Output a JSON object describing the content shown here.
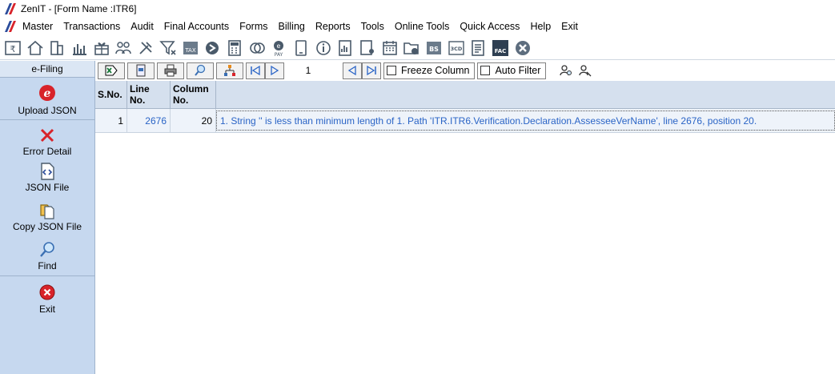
{
  "window": {
    "title": "ZenIT - [Form Name :ITR6]"
  },
  "menu": [
    {
      "label": "Master"
    },
    {
      "label": "Transactions"
    },
    {
      "label": "Audit"
    },
    {
      "label": "Final Accounts"
    },
    {
      "label": "Forms"
    },
    {
      "label": "Billing"
    },
    {
      "label": "Reports"
    },
    {
      "label": "Tools"
    },
    {
      "label": "Online Tools"
    },
    {
      "label": "Quick Access"
    },
    {
      "label": "Help"
    },
    {
      "label": "Exit"
    }
  ],
  "toolbar_icons": [
    "rupee-icon",
    "home-icon",
    "building-icon",
    "bar-chart-icon",
    "gift-icon",
    "users-icon",
    "tools-icon",
    "filter-icon",
    "tax-icon",
    "return-icon",
    "calculator-icon",
    "coins-icon",
    "e-pay-icon",
    "tablet-icon",
    "info-icon",
    "report-icon",
    "user-report-icon",
    "calendar-icon",
    "folder-add-icon",
    "bs-icon",
    "3cd-icon",
    "document-icon",
    "fac-icon",
    "close-circle-icon"
  ],
  "sidebar": {
    "header": "e-Filing",
    "items": [
      {
        "label": "Upload JSON",
        "icon": "e-filing-icon"
      },
      {
        "label": "Error Detail",
        "icon": "x-icon"
      },
      {
        "label": "JSON File",
        "icon": "code-file-icon"
      },
      {
        "label": "Copy JSON File",
        "icon": "copy-file-icon"
      },
      {
        "label": "Find",
        "icon": "magnifier-icon"
      },
      {
        "label": "Exit",
        "icon": "exit-icon"
      }
    ]
  },
  "grid_toolbar": {
    "page": "1",
    "freeze_column": "Freeze Column",
    "auto_filter": "Auto Filter"
  },
  "grid": {
    "columns": [
      "S.No.",
      "Line No.",
      "Column No.",
      ""
    ],
    "rows": [
      {
        "sno": "1",
        "line": "2676",
        "col": "20",
        "desc": "1. String '' is less than minimum length of 1. Path 'ITR.ITR6.Verification.Declaration.AssesseeVerName', line 2676, position 20."
      }
    ]
  }
}
